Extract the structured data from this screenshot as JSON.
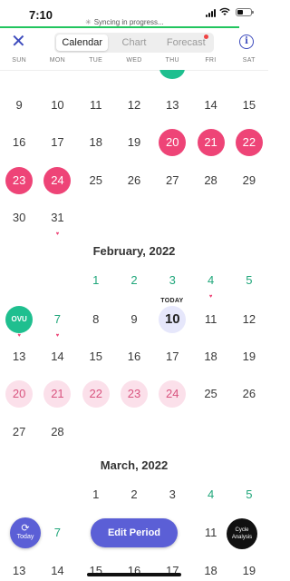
{
  "status": {
    "time": "7:10",
    "sync": "Syncing in progress..."
  },
  "nav": {
    "tabs": [
      {
        "label": "Calendar",
        "active": true
      },
      {
        "label": "Chart",
        "active": false
      },
      {
        "label": "Forecast",
        "active": false,
        "dot": true
      }
    ]
  },
  "weekdays": [
    "SUN",
    "MON",
    "TUE",
    "WED",
    "THU",
    "FRI",
    "SAT"
  ],
  "jan_rows": [
    [
      {
        "t": "9"
      },
      {
        "t": "10"
      },
      {
        "t": "11"
      },
      {
        "t": "12"
      },
      {
        "t": "13"
      },
      {
        "t": "14"
      },
      {
        "t": "15"
      }
    ],
    [
      {
        "t": "16"
      },
      {
        "t": "17"
      },
      {
        "t": "18"
      },
      {
        "t": "19"
      },
      {
        "t": "20",
        "k": "period"
      },
      {
        "t": "21",
        "k": "period"
      },
      {
        "t": "22",
        "k": "period"
      }
    ],
    [
      {
        "t": "23",
        "k": "period"
      },
      {
        "t": "24",
        "k": "period"
      },
      {
        "t": "25"
      },
      {
        "t": "26"
      },
      {
        "t": "27"
      },
      {
        "t": "28"
      },
      {
        "t": "29"
      }
    ],
    [
      {
        "t": "30"
      },
      {
        "t": "31",
        "h": true
      },
      null,
      null,
      null,
      null,
      null
    ]
  ],
  "feb_title": "February, 2022",
  "feb_rows": [
    [
      null,
      null,
      {
        "t": "1",
        "k": "fertile"
      },
      {
        "t": "2",
        "k": "fertile"
      },
      {
        "t": "3",
        "k": "fertile"
      },
      {
        "t": "4",
        "k": "fertile",
        "h": true
      },
      {
        "t": "5",
        "k": "fertile"
      }
    ],
    [
      {
        "t": "OVU",
        "k": "ovu",
        "h": true
      },
      {
        "t": "7",
        "k": "fertile",
        "h": true
      },
      {
        "t": "8"
      },
      {
        "t": "9"
      },
      {
        "t": "10",
        "k": "today"
      },
      {
        "t": "11"
      },
      {
        "t": "12"
      }
    ],
    [
      {
        "t": "13"
      },
      {
        "t": "14"
      },
      {
        "t": "15"
      },
      {
        "t": "16"
      },
      {
        "t": "17"
      },
      {
        "t": "18"
      },
      {
        "t": "19"
      }
    ],
    [
      {
        "t": "20",
        "k": "predicted"
      },
      {
        "t": "21",
        "k": "predicted"
      },
      {
        "t": "22",
        "k": "predicted"
      },
      {
        "t": "23",
        "k": "predicted"
      },
      {
        "t": "24",
        "k": "predicted"
      },
      {
        "t": "25"
      },
      {
        "t": "26"
      }
    ],
    [
      {
        "t": "27"
      },
      {
        "t": "28"
      },
      null,
      null,
      null,
      null,
      null
    ]
  ],
  "today_label": "TODAY",
  "mar_title": "March, 2022",
  "mar_rows": [
    [
      null,
      null,
      {
        "t": "1"
      },
      {
        "t": "2"
      },
      {
        "t": "3"
      },
      {
        "t": "4",
        "k": "fertile"
      },
      {
        "t": "5",
        "k": "fertile"
      }
    ],
    [
      null,
      {
        "t": "7",
        "k": "fertile"
      },
      null,
      null,
      null,
      {
        "t": "11"
      },
      null
    ],
    [
      {
        "t": "13"
      },
      {
        "t": "14"
      },
      {
        "t": "15"
      },
      {
        "t": "16"
      },
      {
        "t": "17"
      },
      {
        "t": "18"
      },
      {
        "t": "19"
      }
    ]
  ],
  "buttons": {
    "today": "Today",
    "edit_period": "Edit Period",
    "cycle_line1": "Cycle",
    "cycle_line2": "Analysis"
  },
  "colors": {
    "accent": "#5b5fd6",
    "period": "#ee4477",
    "fertile": "#1fa67a",
    "ovulation": "#1fbf8f"
  }
}
